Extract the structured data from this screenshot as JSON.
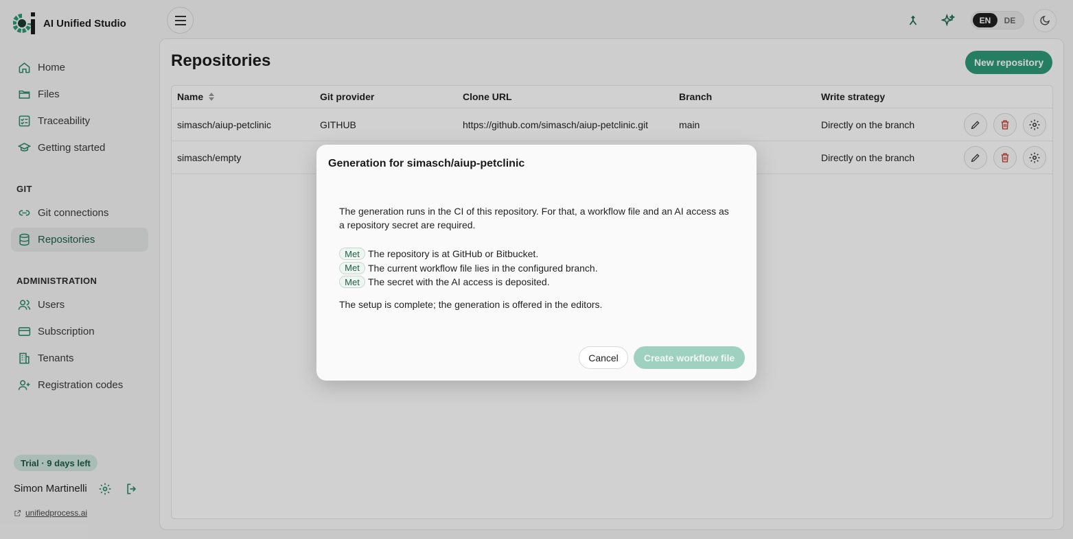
{
  "app": {
    "name": "AI Unified Studio"
  },
  "sidebar": {
    "nav": [
      {
        "label": "Home",
        "icon": "home-icon"
      },
      {
        "label": "Files",
        "icon": "folder-icon"
      },
      {
        "label": "Traceability",
        "icon": "checklist-icon"
      },
      {
        "label": "Getting started",
        "icon": "graduation-cap-icon"
      }
    ],
    "git_label": "GIT",
    "git": [
      {
        "label": "Git connections",
        "icon": "link-icon"
      },
      {
        "label": "Repositories",
        "icon": "database-icon",
        "active": true
      }
    ],
    "admin_label": "ADMINISTRATION",
    "admin": [
      {
        "label": "Users",
        "icon": "users-icon"
      },
      {
        "label": "Subscription",
        "icon": "credit-card-icon"
      },
      {
        "label": "Tenants",
        "icon": "building-icon"
      },
      {
        "label": "Registration codes",
        "icon": "user-plus-icon"
      }
    ],
    "trial": "Trial · 9 days left",
    "user_name": "Simon Martinelli",
    "link": "unifiedprocess.ai"
  },
  "topbar": {
    "languages": [
      "EN",
      "DE"
    ],
    "selected_language": "EN"
  },
  "main": {
    "title": "Repositories",
    "new_button": "New repository",
    "columns": [
      "Name",
      "Git provider",
      "Clone URL",
      "Branch",
      "Write strategy"
    ],
    "rows": [
      {
        "name": "simasch/aiup-petclinic",
        "provider": "GITHUB",
        "url": "https://github.com/simasch/aiup-petclinic.git",
        "branch": "main",
        "strategy": "Directly on the branch"
      },
      {
        "name": "simasch/empty",
        "provider": "",
        "url": "",
        "branch": "",
        "strategy": "Directly on the branch"
      }
    ]
  },
  "modal": {
    "title": "Generation for simasch/aiup-petclinic",
    "intro": "The generation runs in the CI of this repository. For that, a workflow file and an AI access as a repository secret are required.",
    "checks": [
      {
        "badge": "Met",
        "text": "The repository is at GitHub or Bitbucket."
      },
      {
        "badge": "Met",
        "text": "The current workflow file lies in the configured branch."
      },
      {
        "badge": "Met",
        "text": "The secret with the AI access is deposited."
      }
    ],
    "done": "The setup is complete; the generation is offered in the editors.",
    "cancel": "Cancel",
    "create": "Create workflow file"
  },
  "colors": {
    "accent": "#2f9a78",
    "accent_disabled": "#9ed1bf",
    "danger": "#c0392b"
  }
}
